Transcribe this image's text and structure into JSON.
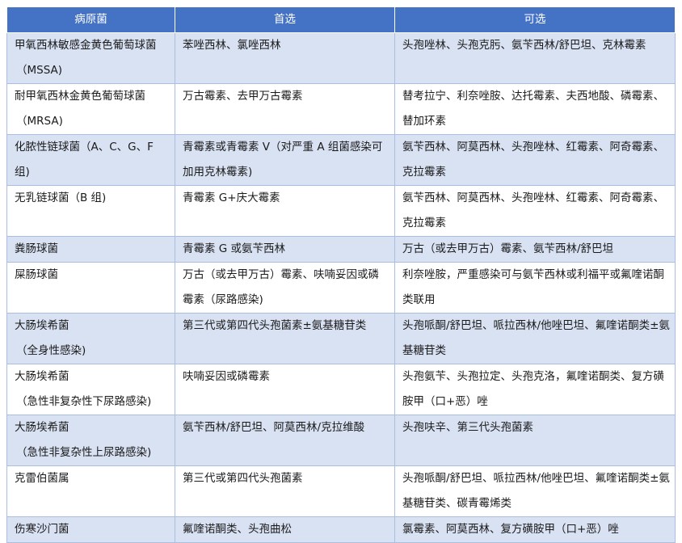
{
  "colors": {
    "header_bg": "#4472c4",
    "band": "#d9e2f3",
    "border": "#a9bfe2"
  },
  "table": {
    "headers": [
      "病原菌",
      "首选",
      "可选"
    ],
    "rows": [
      {
        "pathogen": "甲氧西林敏感金黄色葡萄球菌",
        "pathogen_sub": "（MSSA)",
        "first": "苯唑西林、氯唑西林",
        "alt": "头孢唑林、头孢克肟、氨苄西林/舒巴坦、克林霉素"
      },
      {
        "pathogen": "耐甲氧西林金黄色葡萄球菌",
        "pathogen_sub": "（MRSA)",
        "first": "万古霉素、去甲万古霉素",
        "alt": "替考拉宁、利奈唑胺、达托霉素、夫西地酸、磷霉素、替加环素"
      },
      {
        "pathogen": "化脓性链球菌（A、C、G、F 组)",
        "pathogen_sub": "",
        "first": "青霉素或青霉素 V（对严重 A 组菌感染可加用克林霉素)",
        "alt": "氨苄西林、阿莫西林、头孢唑林、红霉素、阿奇霉素、克拉霉素"
      },
      {
        "pathogen": "无乳链球菌（B 组)",
        "pathogen_sub": "",
        "first": "青霉素 G+庆大霉素",
        "alt": "氨苄西林、阿莫西林、头孢唑林、红霉素、阿奇霉素、克拉霉素"
      },
      {
        "pathogen": "粪肠球菌",
        "pathogen_sub": "",
        "first": "青霉素 G 或氨苄西林",
        "alt": "万古（或去甲万古）霉素、氨苄西林/舒巴坦"
      },
      {
        "pathogen": "屎肠球菌",
        "pathogen_sub": "",
        "first": "万古（或去甲万古）霉素、呋喃妥因或磷霉素（尿路感染)",
        "alt": "利奈唑胺，严重感染可与氨苄西林或利福平或氟喹诺酮类联用"
      },
      {
        "pathogen": "大肠埃希菌",
        "pathogen_sub": "（全身性感染)",
        "first": "第三代或第四代头孢菌素±氨基糖苷类",
        "alt": "头孢哌酮/舒巴坦、哌拉西林/他唑巴坦、氟喹诺酮类±氨基糖苷类"
      },
      {
        "pathogen": "大肠埃希菌",
        "pathogen_sub": "（急性非复杂性下尿路感染)",
        "first": "呋喃妥因或磷霉素",
        "alt": "头孢氨苄、头孢拉定、头孢克洛，氟喹诺酮类、复方磺胺甲（口+恶）唑"
      },
      {
        "pathogen": "大肠埃希菌",
        "pathogen_sub": "（急性非复杂性上尿路感染)",
        "first": "氨苄西林/舒巴坦、阿莫西林/克拉维酸",
        "alt": "头孢呋辛、第三代头孢菌素"
      },
      {
        "pathogen": "克雷伯菌属",
        "pathogen_sub": "",
        "first": "第三代或第四代头孢菌素",
        "alt": "头孢哌酮/舒巴坦、哌拉西林/他唑巴坦、氟喹诺酮类±氨基糖苷类、碳青霉烯类"
      },
      {
        "pathogen": "伤寒沙门菌",
        "pathogen_sub": "",
        "first": "氟喹诺酮类、头孢曲松",
        "alt": "氯霉素、阿莫西林、复方磺胺甲（口+恶）唑"
      }
    ]
  }
}
